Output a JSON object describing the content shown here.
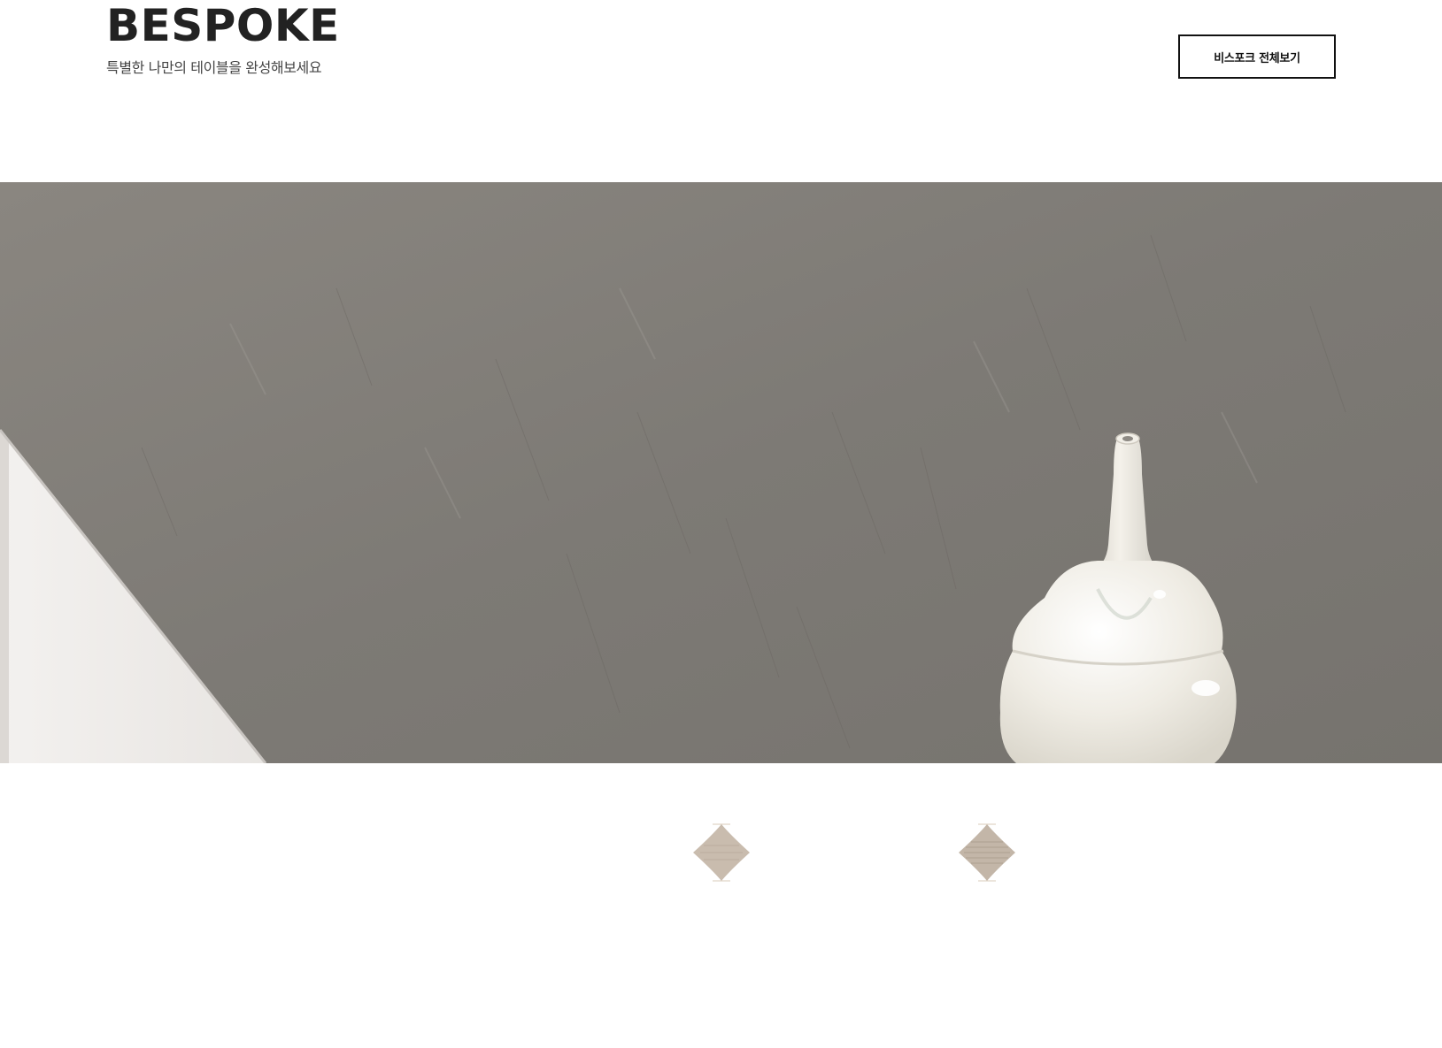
{
  "header": {
    "title": "BESPOKE",
    "subtitle": "특별한 나만의 테이블을 완성해보세요",
    "view_all_label": "비스포크 전체보기"
  },
  "hero": {
    "image_description_icon": "hero-table-vase-image",
    "surface_color": "#7e7b76",
    "vase_color": "#eeeae0"
  },
  "swatches": [
    {
      "name": "swatch-1",
      "color": "#c9bcae"
    },
    {
      "name": "swatch-2",
      "color": "#c3b6a8"
    }
  ],
  "colors": {
    "text": "#222222",
    "subtitle": "#444444",
    "button_border": "#111111",
    "background": "#ffffff"
  }
}
